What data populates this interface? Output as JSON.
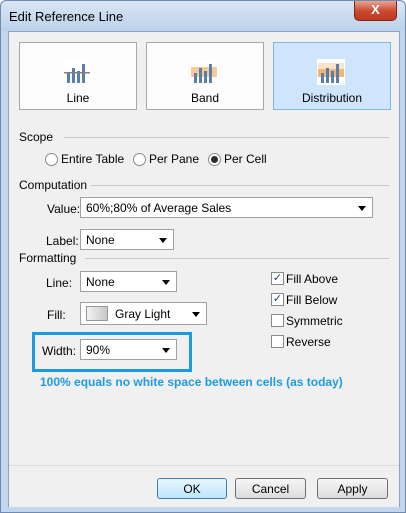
{
  "window": {
    "title": "Edit Reference Line",
    "close_glyph": "X"
  },
  "modes": [
    {
      "label": "Line",
      "icon": "line-chart-icon",
      "selected": false
    },
    {
      "label": "Band",
      "icon": "band-chart-icon",
      "selected": false
    },
    {
      "label": "Distribution",
      "icon": "distribution-chart-icon",
      "selected": true
    }
  ],
  "scope": {
    "heading": "Scope",
    "options": [
      {
        "label": "Entire Table",
        "selected": false
      },
      {
        "label": "Per Pane",
        "selected": false
      },
      {
        "label": "Per Cell",
        "selected": true
      }
    ]
  },
  "computation": {
    "heading": "Computation",
    "value_label": "Value:",
    "value": "60%;80% of Average Sales",
    "label_label": "Label:",
    "label_value": "None"
  },
  "formatting": {
    "heading": "Formatting",
    "line_label": "Line:",
    "line_value": "None",
    "fill_label": "Fill:",
    "fill_value": "Gray Light",
    "width_label": "Width:",
    "width_value": "90%",
    "checkboxes": [
      {
        "label": "Fill Above",
        "checked": true
      },
      {
        "label": "Fill Below",
        "checked": true
      },
      {
        "label": "Symmetric",
        "checked": false
      },
      {
        "label": "Reverse",
        "checked": false
      }
    ],
    "check_glyph": "✓"
  },
  "annotation": {
    "text": "100% equals no white space between cells (as today)",
    "color": "#1e9be0"
  },
  "buttons": {
    "ok": "OK",
    "cancel": "Cancel",
    "apply": "Apply"
  }
}
